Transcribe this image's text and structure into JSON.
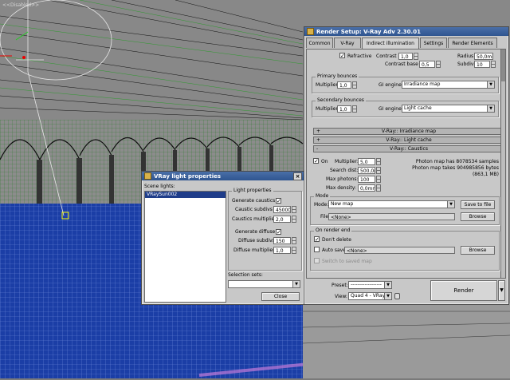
{
  "viewport": {
    "label": "<<Disabled>>"
  },
  "light_dialog": {
    "title": "VRay light properties",
    "close_glyph": "×",
    "scene_lights_label": "Scene lights:",
    "scene_lights": [
      "VRaySun002"
    ],
    "light_properties": {
      "group_title": "Light properties",
      "generate_caustics_label": "Generate caustics",
      "generate_caustics_checked": true,
      "caustic_subdivs_label": "Caustic subdivs",
      "caustic_subdivs": "45000",
      "caustics_multiplier_label": "Caustics multiplier",
      "caustics_multiplier": "2,0",
      "generate_diffuse_label": "Generate diffuse",
      "generate_diffuse_checked": true,
      "diffuse_subdivs_label": "Diffuse subdivs",
      "diffuse_subdivs": "150",
      "diffuse_multiplier_label": "Diffuse multiplier",
      "diffuse_multiplier": "1,0"
    },
    "selection_sets_label": "Selection sets:",
    "selection_sets_value": "",
    "close_button": "Close"
  },
  "render_setup": {
    "title": "Render Setup: V-Ray Adv 2.30.01",
    "tabs": [
      {
        "label": "Common",
        "active": false
      },
      {
        "label": "V-Ray",
        "active": false
      },
      {
        "label": "Indirect illumination",
        "active": true
      },
      {
        "label": "Settings",
        "active": false
      },
      {
        "label": "Render Elements",
        "active": false
      }
    ],
    "refractive_label": "Refractive",
    "refractive_checked": true,
    "contrast_label": "Contrast",
    "contrast": "1,0",
    "contrast_base_label": "Contrast base",
    "contrast_base": "0,5",
    "radius_label": "Radius",
    "radius": "50,0mi",
    "subdivs_label": "Subdivs",
    "subdivs": "10",
    "primary": {
      "group_title": "Primary bounces",
      "multiplier_label": "Multiplier",
      "multiplier": "1,0",
      "gi_engine_label": "GI engine",
      "gi_engine": "Irradiance map"
    },
    "secondary": {
      "group_title": "Secondary bounces",
      "multiplier_label": "Multiplier",
      "multiplier": "1,0",
      "gi_engine_label": "GI engine",
      "gi_engine": "Light cache"
    },
    "rollouts": [
      {
        "sign": "+",
        "label": "V-Ray:: Irradiance map"
      },
      {
        "sign": "+",
        "label": "V-Ray:: Light cache"
      },
      {
        "sign": "-",
        "label": "V-Ray:: Caustics"
      }
    ],
    "caustics": {
      "on_label": "On",
      "on_checked": true,
      "multiplier_label": "Multiplier:",
      "multiplier": "5,0",
      "search_dist_label": "Search dist:",
      "search_dist": "500,0mi",
      "max_photons_label": "Max photons:",
      "max_photons": "100",
      "max_density_label": "Max density:",
      "max_density": "0,0mm",
      "info_line1": "Photon map has 8078534 samples",
      "info_line2": "Photon map takes 904985856 bytes",
      "info_line3": "(863,1 MB)",
      "mode_group_title": "Mode",
      "mode_label": "Mode:",
      "mode_value": "New map",
      "save_to_file": "Save to file",
      "file_label": "File:",
      "file_value": "<None>",
      "browse": "Browse",
      "on_render_end_title": "On render end",
      "dont_delete_label": "Don't delete",
      "dont_delete_checked": true,
      "auto_save_label": "Auto save:",
      "auto_save_checked": false,
      "auto_save_value": "<None>",
      "browse2": "Browse",
      "switch_saved_label": "Switch to saved map"
    },
    "bottom": {
      "preset_label": "Preset:",
      "preset_value": "------------------",
      "view_label": "View:",
      "view_value": "Quad 4 - VRayP",
      "render_button": "Render"
    }
  },
  "colors": {
    "titlebar": "#2f5590",
    "floor": "#1c3a9a",
    "selection": "#1f3d8a"
  }
}
